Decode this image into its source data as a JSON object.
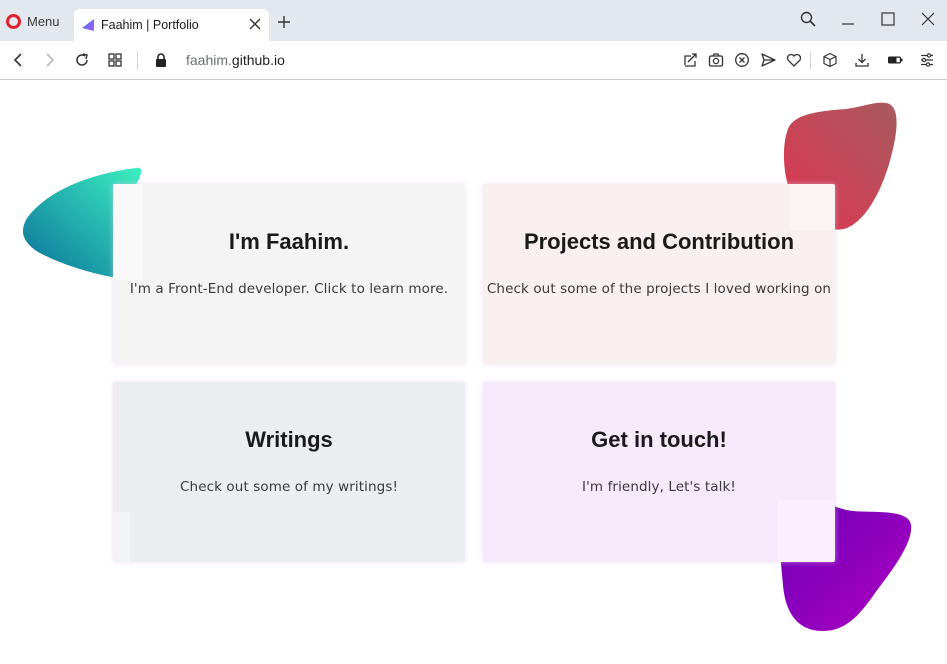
{
  "browser": {
    "menu_label": "Menu",
    "tab_title": "Faahim | Portfolio",
    "url_subdomain": "faahim.",
    "url_domain": "github.io"
  },
  "cards": [
    {
      "title": "I'm Faahim.",
      "text": "I'm a Front-End developer. Click to learn more.",
      "bg": "#f4f4f4"
    },
    {
      "title": "Projects and Contribution",
      "text": "Check out some of the projects I loved working on",
      "bg": "#f8f0ee"
    },
    {
      "title": "Writings",
      "text": "Check out some of my writings!",
      "bg": "#ebedf0"
    },
    {
      "title": "Get in touch!",
      "text": "I'm friendly, Let's talk!",
      "bg": "#f6e9f9"
    }
  ],
  "colors": {
    "opera_red": "#e0212e",
    "blob_teal": [
      "#3cf0c0",
      "#0a6f9a"
    ],
    "blob_red": [
      "#a85a5f",
      "#e03550"
    ],
    "blob_orange": [
      "#ff8a00",
      "#ff4500"
    ],
    "blob_purple": [
      "#6a00b8",
      "#b000c0"
    ]
  }
}
